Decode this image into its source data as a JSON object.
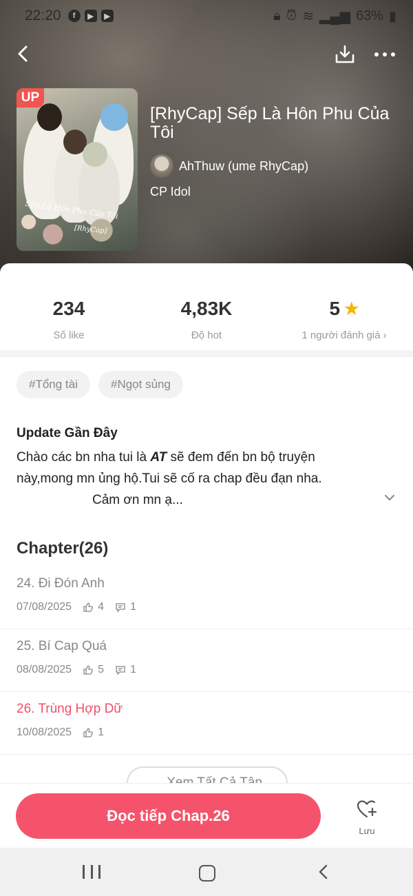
{
  "status_bar": {
    "time": "22:20",
    "battery": "63%"
  },
  "book": {
    "badge": "UP",
    "title": "[RhyCap] Sếp Là Hôn Phu Của Tôi",
    "author": "AhThuw (ume RhyCap)",
    "category": "CP Idol",
    "cover_script": "Sếp Là Hôn Phu Của Tôi",
    "cover_script2": "[RhyCap]"
  },
  "stats": {
    "likes": {
      "value": "234",
      "label": "Số like"
    },
    "hot": {
      "value": "4,83K",
      "label": "Độ hot"
    },
    "rating": {
      "value": "5",
      "label": "1 người đánh giá"
    }
  },
  "tags": [
    "#Tổng tài",
    "#Ngọt sủng"
  ],
  "update": {
    "title": "Update Gần Đây",
    "text_before": "Chào các bn nha tui là ",
    "text_bold": "AT",
    "text_after": " sẽ đem đến bn bộ truyện này,mong mn ủng hộ.Tui sẽ cố ra chap đều đạn nha.",
    "text_line3": "Cảm ơn mn ạ..."
  },
  "chapters": {
    "header": "Chapter(26)",
    "items": [
      {
        "title": "24. Đi Đón Anh",
        "date": "07/08/2025",
        "likes": "4",
        "comments": "1"
      },
      {
        "title": "25. Bí Cap Quá",
        "date": "08/08/2025",
        "likes": "5",
        "comments": "1"
      },
      {
        "title": "26. Trùng Hợp Dữ",
        "date": "10/08/2025",
        "likes": "1"
      }
    ],
    "view_all": "Xem Tất Cả Tập"
  },
  "bottom": {
    "cta": "Đọc tiếp Chap.26",
    "save": "Lưu"
  },
  "colors": {
    "accent": "#f5536b",
    "star": "#f7b500",
    "badge": "#f2544f"
  }
}
